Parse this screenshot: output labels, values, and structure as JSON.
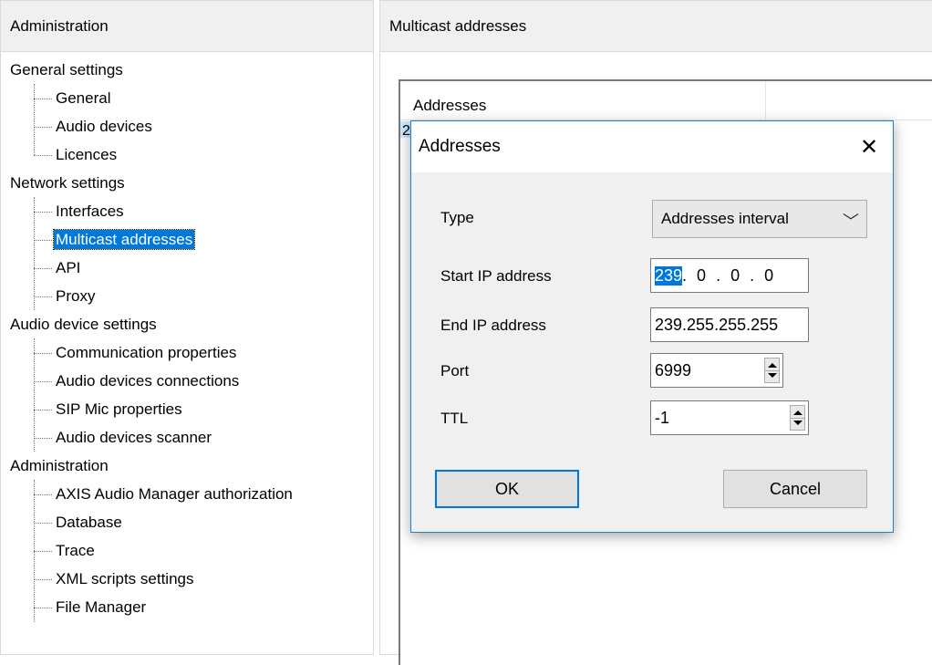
{
  "left_panel": {
    "title": "Administration",
    "tree": [
      {
        "type": "category",
        "label": "General settings"
      },
      {
        "type": "child",
        "label": "General"
      },
      {
        "type": "child",
        "label": "Audio devices"
      },
      {
        "type": "child",
        "label": "Licences"
      },
      {
        "type": "category",
        "label": "Network settings"
      },
      {
        "type": "child",
        "label": "Interfaces"
      },
      {
        "type": "child",
        "label": "Multicast addresses",
        "selected": true
      },
      {
        "type": "child",
        "label": "API"
      },
      {
        "type": "child",
        "label": "Proxy"
      },
      {
        "type": "category",
        "label": "Audio device settings"
      },
      {
        "type": "child",
        "label": "Communication properties"
      },
      {
        "type": "child",
        "label": "Audio devices connections"
      },
      {
        "type": "child",
        "label": "SIP Mic properties"
      },
      {
        "type": "child",
        "label": "Audio devices scanner"
      },
      {
        "type": "category",
        "label": "Administration"
      },
      {
        "type": "child",
        "label": "AXIS Audio Manager authorization"
      },
      {
        "type": "child",
        "label": "Database"
      },
      {
        "type": "child",
        "label": "Trace"
      },
      {
        "type": "child",
        "label": "XML scripts settings"
      },
      {
        "type": "child",
        "label": "File Manager"
      }
    ]
  },
  "right_panel": {
    "title": "Multicast addresses",
    "list": {
      "columns": [
        "Addresses",
        ""
      ],
      "first_row_stub": "2"
    }
  },
  "dialog": {
    "title": "Addresses",
    "close_icon": "close-icon",
    "type_label": "Type",
    "type_value": "Addresses interval",
    "start_ip_label": "Start IP address",
    "start_ip_segments": [
      "239",
      "0",
      "0",
      "0"
    ],
    "end_ip_label": "End IP address",
    "end_ip_value": "239.255.255.255",
    "port_label": "Port",
    "port_value": "6999",
    "ttl_label": "TTL",
    "ttl_value": "-1",
    "ok_label": "OK",
    "cancel_label": "Cancel"
  },
  "colors": {
    "selection": "#0078d7",
    "dialog_border": "#1883d7",
    "panel_header": "#f0f0f0"
  }
}
